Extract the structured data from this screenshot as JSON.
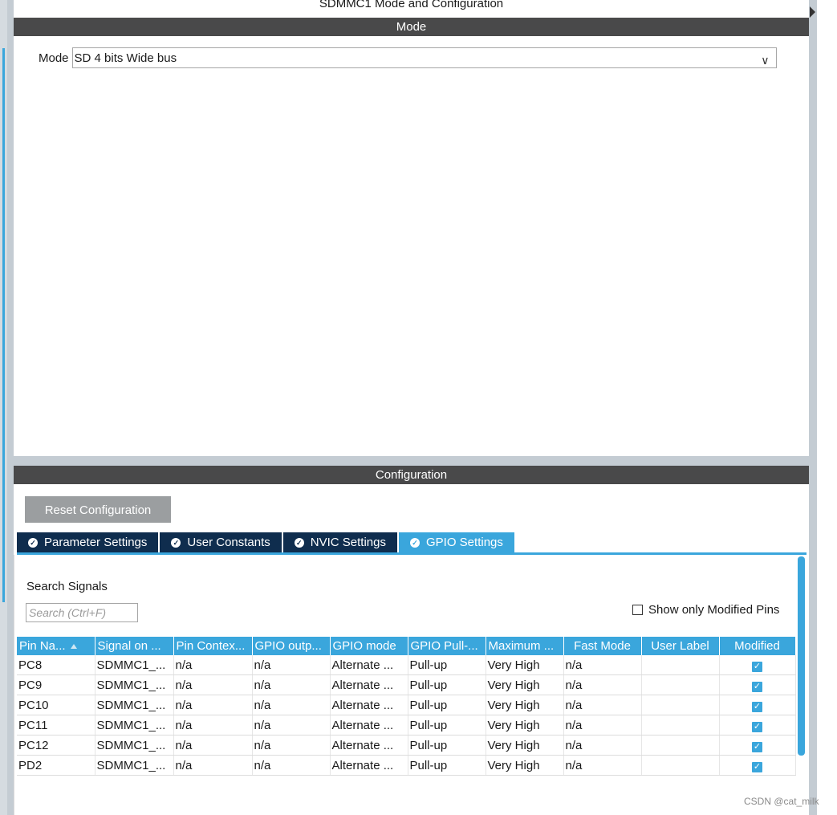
{
  "window": {
    "title": "SDMMC1 Mode and Configuration"
  },
  "mode_section": {
    "header": "Mode",
    "mode_label": "Mode",
    "mode_value": "SD 4 bits Wide bus"
  },
  "config_section": {
    "header": "Configuration",
    "reset_button": "Reset Configuration",
    "tabs": [
      {
        "label": "Parameter Settings",
        "active": false
      },
      {
        "label": "User Constants",
        "active": false
      },
      {
        "label": "NVIC Settings",
        "active": false
      },
      {
        "label": "GPIO Settings",
        "active": true
      }
    ],
    "search": {
      "label": "Search Signals",
      "placeholder": "Search (Ctrl+F)"
    },
    "show_modified_label": "Show only Modified Pins",
    "show_modified_checked": false
  },
  "gpio_table": {
    "columns": [
      "Pin Na...",
      "Signal on ...",
      "Pin Contex...",
      "GPIO outp...",
      "GPIO mode",
      "GPIO Pull-...",
      "Maximum ...",
      "Fast Mode",
      "User Label",
      "Modified"
    ],
    "rows": [
      {
        "pin": "PC8",
        "signal": "SDMMC1_...",
        "context": "n/a",
        "output": "n/a",
        "mode": "Alternate ...",
        "pull": "Pull-up",
        "speed": "Very High",
        "fast": "n/a",
        "label": "",
        "modified": true
      },
      {
        "pin": "PC9",
        "signal": "SDMMC1_...",
        "context": "n/a",
        "output": "n/a",
        "mode": "Alternate ...",
        "pull": "Pull-up",
        "speed": "Very High",
        "fast": "n/a",
        "label": "",
        "modified": true
      },
      {
        "pin": "PC10",
        "signal": "SDMMC1_...",
        "context": "n/a",
        "output": "n/a",
        "mode": "Alternate ...",
        "pull": "Pull-up",
        "speed": "Very High",
        "fast": "n/a",
        "label": "",
        "modified": true
      },
      {
        "pin": "PC11",
        "signal": "SDMMC1_...",
        "context": "n/a",
        "output": "n/a",
        "mode": "Alternate ...",
        "pull": "Pull-up",
        "speed": "Very High",
        "fast": "n/a",
        "label": "",
        "modified": true
      },
      {
        "pin": "PC12",
        "signal": "SDMMC1_...",
        "context": "n/a",
        "output": "n/a",
        "mode": "Alternate ...",
        "pull": "Pull-up",
        "speed": "Very High",
        "fast": "n/a",
        "label": "",
        "modified": true
      },
      {
        "pin": "PD2",
        "signal": "SDMMC1_...",
        "context": "n/a",
        "output": "n/a",
        "mode": "Alternate ...",
        "pull": "Pull-up",
        "speed": "Very High",
        "fast": "n/a",
        "label": "",
        "modified": true
      }
    ]
  },
  "watermark": "CSDN @cat_milk",
  "colors": {
    "accent": "#3aa6dc",
    "tab_dark": "#0f2d4e",
    "section_bar": "#49494a",
    "button_gray": "#9b9ea0"
  }
}
